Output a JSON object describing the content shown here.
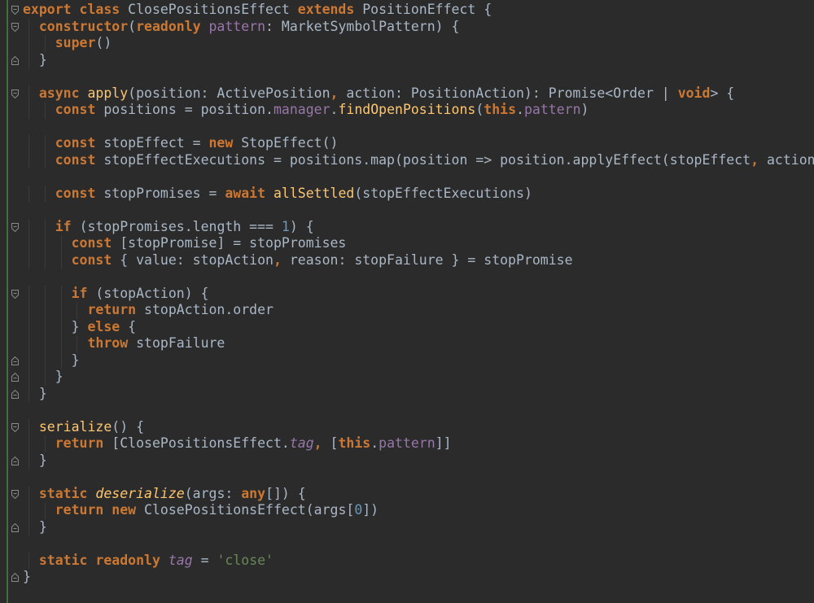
{
  "editor": {
    "theme_colors": {
      "background": "#2b2b2b",
      "keyword": "#cc7832",
      "function": "#ffc66d",
      "property": "#9876aa",
      "number": "#6897bb",
      "string": "#6a8759",
      "default": "#a9b7c6"
    },
    "lines": [
      {
        "indent": 0,
        "fold": "open",
        "tokens": [
          [
            "kw",
            "export class "
          ],
          [
            "def",
            "ClosePositionsEffect "
          ],
          [
            "kw",
            "extends "
          ],
          [
            "def",
            "PositionEffect {"
          ]
        ]
      },
      {
        "indent": 1,
        "fold": "open",
        "tokens": [
          [
            "kw",
            "constructor"
          ],
          [
            "def",
            "("
          ],
          [
            "kw",
            "readonly "
          ],
          [
            "prop",
            "pattern"
          ],
          [
            "def",
            ": MarketSymbolPattern) {"
          ]
        ]
      },
      {
        "indent": 2,
        "fold": "",
        "tokens": [
          [
            "kw",
            "super"
          ],
          [
            "def",
            "()"
          ]
        ]
      },
      {
        "indent": 1,
        "fold": "close",
        "tokens": [
          [
            "def",
            "}"
          ]
        ]
      },
      {
        "indent": 0,
        "fold": "",
        "tokens": []
      },
      {
        "indent": 1,
        "fold": "open",
        "tokens": [
          [
            "kw",
            "async "
          ],
          [
            "fn",
            "apply"
          ],
          [
            "def",
            "(position: ActivePosition"
          ],
          [
            "kw",
            ", "
          ],
          [
            "def",
            "action: PositionAction): Promise<Order | "
          ],
          [
            "kw",
            "void"
          ],
          [
            "def",
            "> {"
          ]
        ]
      },
      {
        "indent": 2,
        "fold": "",
        "tokens": [
          [
            "kw",
            "const "
          ],
          [
            "def",
            "positions = position."
          ],
          [
            "prop",
            "manager"
          ],
          [
            "def",
            "."
          ],
          [
            "fn",
            "findOpenPositions"
          ],
          [
            "def",
            "("
          ],
          [
            "kw",
            "this"
          ],
          [
            "def",
            "."
          ],
          [
            "prop",
            "pattern"
          ],
          [
            "def",
            ")"
          ]
        ]
      },
      {
        "indent": 0,
        "fold": "",
        "tokens": []
      },
      {
        "indent": 2,
        "fold": "",
        "tokens": [
          [
            "kw",
            "const "
          ],
          [
            "def",
            "stopEffect = "
          ],
          [
            "kw",
            "new "
          ],
          [
            "def",
            "StopEffect()"
          ]
        ]
      },
      {
        "indent": 2,
        "fold": "",
        "tokens": [
          [
            "kw",
            "const "
          ],
          [
            "def",
            "stopEffectExecutions = positions.map(position => position.applyEffect(stopEffect"
          ],
          [
            "kw",
            ", "
          ],
          [
            "def",
            "action))"
          ]
        ]
      },
      {
        "indent": 0,
        "fold": "",
        "tokens": []
      },
      {
        "indent": 2,
        "fold": "",
        "tokens": [
          [
            "kw",
            "const "
          ],
          [
            "def",
            "stopPromises = "
          ],
          [
            "kw",
            "await "
          ],
          [
            "fn",
            "allSettled"
          ],
          [
            "def",
            "(stopEffectExecutions)"
          ]
        ]
      },
      {
        "indent": 0,
        "fold": "",
        "tokens": []
      },
      {
        "indent": 2,
        "fold": "open",
        "tokens": [
          [
            "kw",
            "if "
          ],
          [
            "def",
            "(stopPromises.length === "
          ],
          [
            "num",
            "1"
          ],
          [
            "def",
            ") {"
          ]
        ]
      },
      {
        "indent": 3,
        "fold": "",
        "tokens": [
          [
            "kw",
            "const "
          ],
          [
            "def",
            "[stopPromise] = stopPromises"
          ]
        ]
      },
      {
        "indent": 3,
        "fold": "",
        "tokens": [
          [
            "kw",
            "const "
          ],
          [
            "def",
            "{ value: stopAction"
          ],
          [
            "kw",
            ", "
          ],
          [
            "def",
            "reason: stopFailure } = stopPromise"
          ]
        ]
      },
      {
        "indent": 0,
        "fold": "",
        "tokens": []
      },
      {
        "indent": 3,
        "fold": "open",
        "tokens": [
          [
            "kw",
            "if "
          ],
          [
            "def",
            "(stopAction) {"
          ]
        ]
      },
      {
        "indent": 4,
        "fold": "",
        "tokens": [
          [
            "kw",
            "return "
          ],
          [
            "def",
            "stopAction.order"
          ]
        ]
      },
      {
        "indent": 3,
        "fold": "",
        "tokens": [
          [
            "def",
            "} "
          ],
          [
            "kw",
            "else "
          ],
          [
            "def",
            "{"
          ]
        ]
      },
      {
        "indent": 4,
        "fold": "",
        "tokens": [
          [
            "kw",
            "throw "
          ],
          [
            "def",
            "stopFailure"
          ]
        ]
      },
      {
        "indent": 3,
        "fold": "close",
        "tokens": [
          [
            "def",
            "}"
          ]
        ]
      },
      {
        "indent": 2,
        "fold": "close",
        "tokens": [
          [
            "def",
            "}"
          ]
        ]
      },
      {
        "indent": 1,
        "fold": "close",
        "tokens": [
          [
            "def",
            "}"
          ]
        ]
      },
      {
        "indent": 0,
        "fold": "",
        "tokens": []
      },
      {
        "indent": 1,
        "fold": "open",
        "tokens": [
          [
            "fn",
            "serialize"
          ],
          [
            "def",
            "() {"
          ]
        ]
      },
      {
        "indent": 2,
        "fold": "",
        "tokens": [
          [
            "kw",
            "return "
          ],
          [
            "def",
            "[ClosePositionsEffect."
          ],
          [
            "propi",
            "tag"
          ],
          [
            "kw",
            ", "
          ],
          [
            "def",
            "["
          ],
          [
            "kw",
            "this"
          ],
          [
            "def",
            "."
          ],
          [
            "prop",
            "pattern"
          ],
          [
            "def",
            "]]"
          ]
        ]
      },
      {
        "indent": 1,
        "fold": "close",
        "tokens": [
          [
            "def",
            "}"
          ]
        ]
      },
      {
        "indent": 0,
        "fold": "",
        "tokens": []
      },
      {
        "indent": 1,
        "fold": "open",
        "tokens": [
          [
            "kw",
            "static "
          ],
          [
            "fni",
            "deserialize"
          ],
          [
            "def",
            "(args: "
          ],
          [
            "kw",
            "any"
          ],
          [
            "def",
            "[]) {"
          ]
        ]
      },
      {
        "indent": 2,
        "fold": "",
        "tokens": [
          [
            "kw",
            "return new "
          ],
          [
            "def",
            "ClosePositionsEffect(args["
          ],
          [
            "num",
            "0"
          ],
          [
            "def",
            "])"
          ]
        ]
      },
      {
        "indent": 1,
        "fold": "close",
        "tokens": [
          [
            "def",
            "}"
          ]
        ]
      },
      {
        "indent": 0,
        "fold": "",
        "tokens": []
      },
      {
        "indent": 1,
        "fold": "",
        "tokens": [
          [
            "kw",
            "static readonly "
          ],
          [
            "propi",
            "tag"
          ],
          [
            "def",
            " = "
          ],
          [
            "str",
            "'close'"
          ]
        ]
      },
      {
        "indent": 0,
        "fold": "close",
        "tokens": [
          [
            "def",
            "}"
          ]
        ]
      }
    ]
  }
}
